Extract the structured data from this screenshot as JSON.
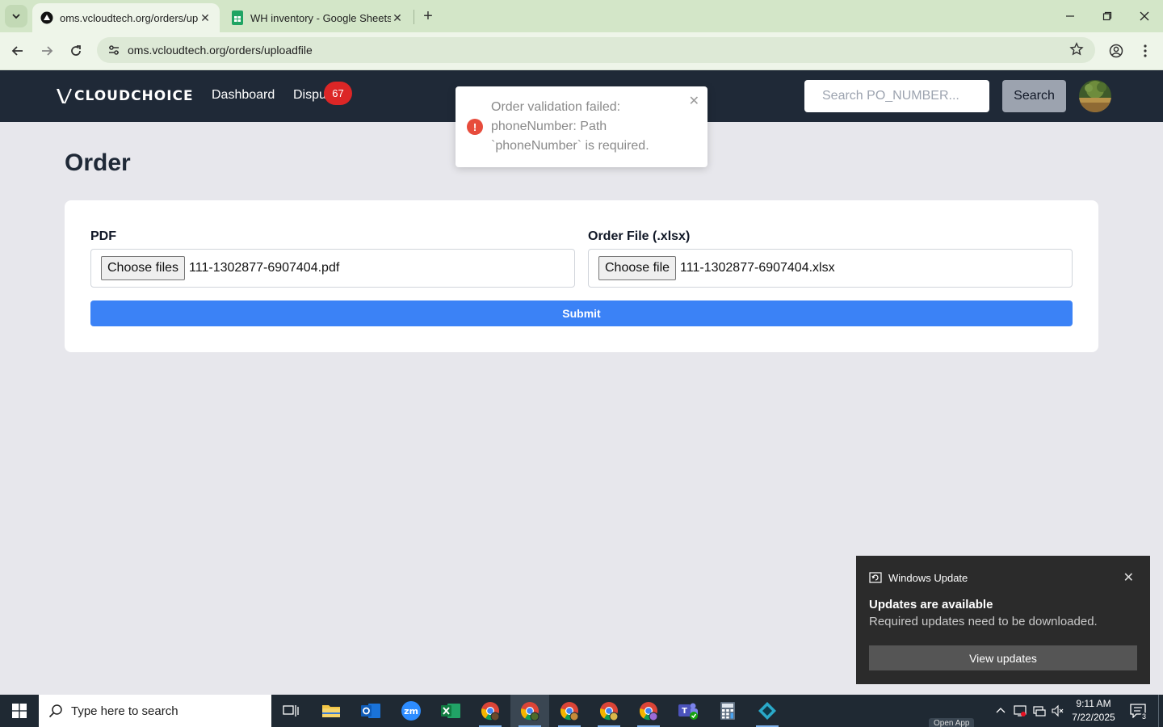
{
  "browser": {
    "tabs": [
      {
        "title": "oms.vcloudtech.org/orders/uploadfile",
        "active": true
      },
      {
        "title": "WH inventory - Google Sheets",
        "active": false
      }
    ],
    "url": "oms.vcloudtech.org/orders/uploadfile"
  },
  "app": {
    "logo_text": "CLOUDCHOICE",
    "nav": {
      "dashboard": "Dashboard",
      "disputes": "Dispu",
      "disputes_badge": "67"
    },
    "search": {
      "placeholder": "Search PO_NUMBER...",
      "button": "Search"
    }
  },
  "page": {
    "title": "Order",
    "pdf": {
      "label": "PDF",
      "button": "Choose files",
      "file": "111-1302877-6907404.pdf"
    },
    "xlsx": {
      "label": "Order File (.xlsx)",
      "button": "Choose file",
      "file": "111-1302877-6907404.xlsx"
    },
    "submit": "Submit"
  },
  "toast": {
    "message": "Order validation failed: phoneNumber: Path `phoneNumber` is required.",
    "icon": "!"
  },
  "windows_update": {
    "title": "Windows Update",
    "heading": "Updates are available",
    "body": "Required updates need to be downloaded.",
    "button": "View updates"
  },
  "taskbar": {
    "search_placeholder": "Type here to search",
    "time": "9:11 AM",
    "date": "7/22/2025",
    "notification_count": "3",
    "open_app": "Open App"
  },
  "colors": {
    "navbar": "#1f2937",
    "submit": "#3b82f6",
    "badge": "#dc2626",
    "error": "#e74c3c"
  }
}
